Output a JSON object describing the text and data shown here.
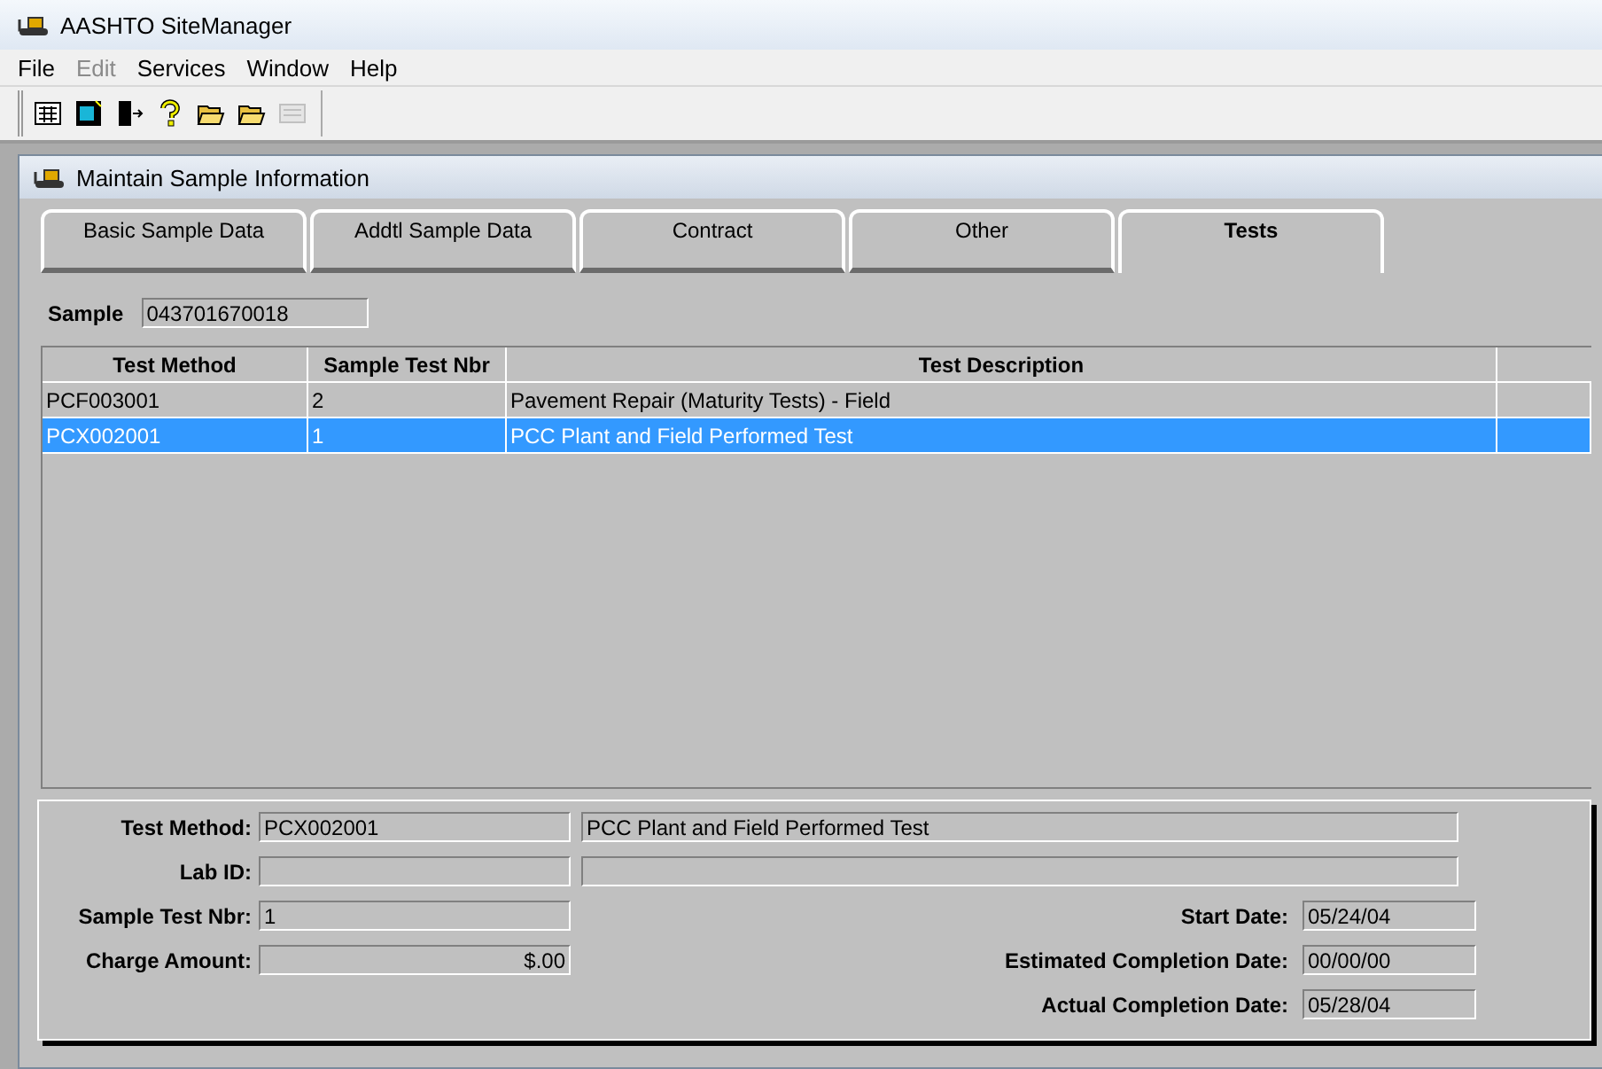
{
  "window": {
    "title": "AASHTO SiteManager"
  },
  "menu": [
    {
      "label": "File",
      "disabled": false
    },
    {
      "label": "Edit",
      "disabled": true
    },
    {
      "label": "Services",
      "disabled": false
    },
    {
      "label": "Window",
      "disabled": false
    },
    {
      "label": "Help",
      "disabled": false
    }
  ],
  "toolbar": [
    {
      "kind": "grid",
      "disabled": false
    },
    {
      "kind": "monitor",
      "disabled": false
    },
    {
      "kind": "door",
      "disabled": false
    },
    {
      "kind": "help",
      "disabled": false
    },
    {
      "kind": "folder",
      "disabled": false
    },
    {
      "kind": "folder",
      "disabled": false
    },
    {
      "kind": "panel",
      "disabled": true
    }
  ],
  "child_window": {
    "title": "Maintain Sample Information"
  },
  "tabs": [
    {
      "label": "Basic Sample Data",
      "selected": false
    },
    {
      "label": "Addtl Sample Data",
      "selected": false
    },
    {
      "label": "Contract",
      "selected": false
    },
    {
      "label": "Other",
      "selected": false
    },
    {
      "label": "Tests",
      "selected": true
    }
  ],
  "sample": {
    "label": "Sample",
    "value": "043701670018"
  },
  "table": {
    "columns": [
      "Test Method",
      "Sample Test Nbr",
      "Test Description"
    ],
    "rows": [
      {
        "cells": [
          "PCF003001",
          "2",
          "Pavement Repair (Maturity Tests) - Field"
        ],
        "selected": false
      },
      {
        "cells": [
          "PCX002001",
          "1",
          "PCC Plant and Field Performed Test"
        ],
        "selected": true
      }
    ]
  },
  "details": {
    "test_method": {
      "label": "Test Method:",
      "value": "PCX002001",
      "description": "PCC Plant and Field Performed Test"
    },
    "lab_id": {
      "label": "Lab ID:"
    },
    "sample_test_nbr": {
      "label": "Sample Test Nbr:",
      "value": "1"
    },
    "charge_amount": {
      "label": "Charge Amount:",
      "value": "$.00"
    },
    "start_date": {
      "label": "Start Date:",
      "value": "05/24/04"
    },
    "estimated_completion_date": {
      "label": "Estimated Completion Date:",
      "value": "00/00/00"
    },
    "actual_completion_date": {
      "label": "Actual Completion Date:",
      "value": "05/28/04"
    }
  }
}
